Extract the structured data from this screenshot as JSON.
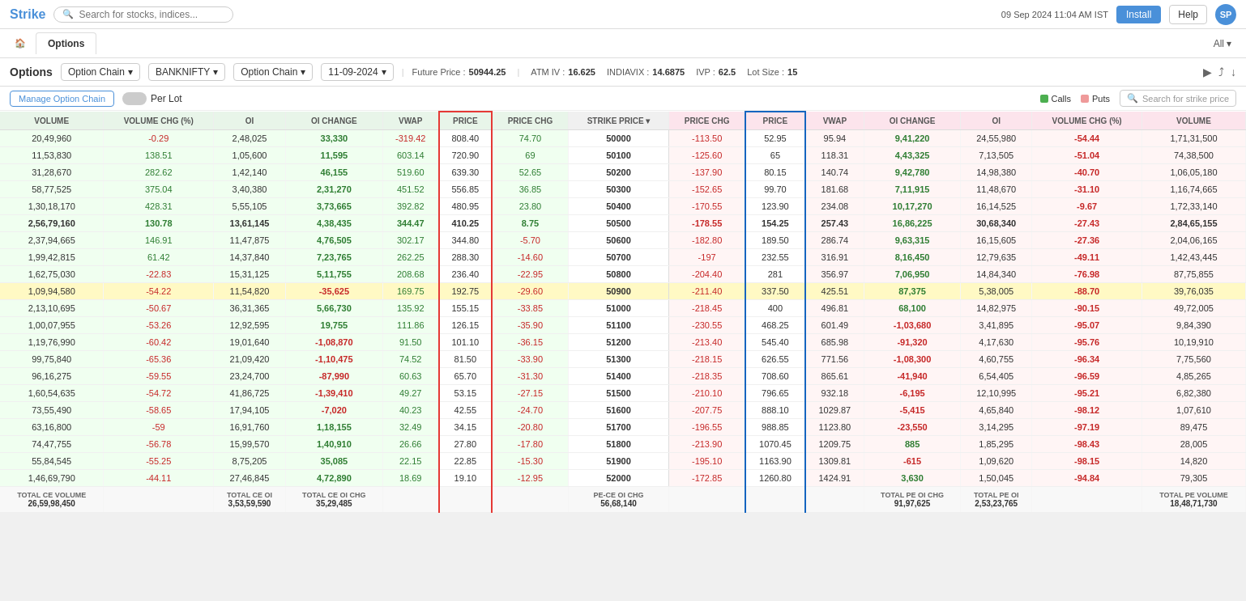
{
  "navbar": {
    "logo": "Strike",
    "search_placeholder": "Search for stocks, indices...",
    "timestamp": "09 Sep 2024 11:04 AM IST",
    "btn_install": "Install",
    "btn_help": "Help",
    "avatar": "SP"
  },
  "tabs": {
    "home_icon": "🏠",
    "active_tab": "Options",
    "all_label": "All"
  },
  "options_bar": {
    "title": "Options",
    "dropdown1": "Option Chain",
    "dropdown2": "BANKNIFTY",
    "dropdown3": "Option Chain",
    "date": "11-09-2024",
    "future_price_label": "Future Price :",
    "future_price_val": "50944.25",
    "atm_iv_label": "ATM IV :",
    "atm_iv_val": "16.625",
    "indiavix_label": "INDIAVIX :",
    "indiavix_val": "14.6875",
    "ivp_label": "IVP :",
    "ivp_val": "62.5",
    "lot_label": "Lot Size :",
    "lot_val": "15"
  },
  "manage_bar": {
    "btn_manage": "Manage Option Chain",
    "per_lot": "Per Lot",
    "legend_calls": "Calls",
    "legend_puts": "Puts",
    "search_placeholder": "Search for strike price"
  },
  "table": {
    "ce_headers": [
      "VOLUME",
      "VOLUME CHG (%)",
      "OI",
      "OI CHANGE",
      "VWAP",
      "PRICE",
      "PRICE CHG"
    ],
    "strike_header": "STRIKE PRICE",
    "pe_headers": [
      "PRICE CHG",
      "PRICE",
      "VWAP",
      "OI CHANGE",
      "OI",
      "VOLUME CHG (%)",
      "VOLUME"
    ],
    "rows": [
      {
        "strike": "50000",
        "ce": {
          "vol": "20,49,960",
          "vol_chg": "-0.29",
          "oi": "2,48,025",
          "oi_chg": "33,330",
          "vwap": "-319.42",
          "price": "808.40",
          "price_chg": "74.70"
        },
        "pe": {
          "price_chg": "-113.50",
          "price": "52.95",
          "vwap": "95.94",
          "oi_chg": "9,41,220",
          "oi": "24,55,980",
          "vol_chg": "-54.44",
          "vol": "1,71,31,500"
        }
      },
      {
        "strike": "50100",
        "ce": {
          "vol": "11,53,830",
          "vol_chg": "138.51",
          "oi": "1,05,600",
          "oi_chg": "11,595",
          "vwap": "603.14",
          "price": "720.90",
          "price_chg": "69"
        },
        "pe": {
          "price_chg": "-125.60",
          "price": "65",
          "vwap": "118.31",
          "oi_chg": "4,43,325",
          "oi": "7,13,505",
          "vol_chg": "-51.04",
          "vol": "74,38,500"
        }
      },
      {
        "strike": "50200",
        "ce": {
          "vol": "31,28,670",
          "vol_chg": "282.62",
          "oi": "1,42,140",
          "oi_chg": "46,155",
          "vwap": "519.60",
          "price": "639.30",
          "price_chg": "52.65"
        },
        "pe": {
          "price_chg": "-137.90",
          "price": "80.15",
          "vwap": "140.74",
          "oi_chg": "9,42,780",
          "oi": "14,98,380",
          "vol_chg": "-40.70",
          "vol": "1,06,05,180"
        }
      },
      {
        "strike": "50300",
        "ce": {
          "vol": "58,77,525",
          "vol_chg": "375.04",
          "oi": "3,40,380",
          "oi_chg": "2,31,270",
          "vwap": "451.52",
          "price": "556.85",
          "price_chg": "36.85"
        },
        "pe": {
          "price_chg": "-152.65",
          "price": "99.70",
          "vwap": "181.68",
          "oi_chg": "7,11,915",
          "oi": "11,48,670",
          "vol_chg": "-31.10",
          "vol": "1,16,74,665"
        }
      },
      {
        "strike": "50400",
        "ce": {
          "vol": "1,30,18,170",
          "vol_chg": "428.31",
          "oi": "5,55,105",
          "oi_chg": "3,73,665",
          "vwap": "392.82",
          "price": "480.95",
          "price_chg": "23.80"
        },
        "pe": {
          "price_chg": "-170.55",
          "price": "123.90",
          "vwap": "234.08",
          "oi_chg": "10,17,270",
          "oi": "16,14,525",
          "vol_chg": "-9.67",
          "vol": "1,72,33,140"
        }
      },
      {
        "strike": "50500",
        "ce": {
          "vol": "2,56,79,160",
          "vol_chg": "130.78",
          "oi": "13,61,145",
          "oi_chg": "4,38,435",
          "vwap": "344.47",
          "price": "410.25",
          "price_chg": "8.75"
        },
        "pe": {
          "price_chg": "-178.55",
          "price": "154.25",
          "vwap": "257.43",
          "oi_chg": "16,86,225",
          "oi": "30,68,340",
          "vol_chg": "-27.43",
          "vol": "2,84,65,155"
        },
        "atm": true
      },
      {
        "strike": "50600",
        "ce": {
          "vol": "2,37,94,665",
          "vol_chg": "146.91",
          "oi": "11,47,875",
          "oi_chg": "4,76,505",
          "vwap": "302.17",
          "price": "344.80",
          "price_chg": "-5.70"
        },
        "pe": {
          "price_chg": "-182.80",
          "price": "189.50",
          "vwap": "286.74",
          "oi_chg": "9,63,315",
          "oi": "16,15,605",
          "vol_chg": "-27.36",
          "vol": "2,04,06,165"
        }
      },
      {
        "strike": "50700",
        "ce": {
          "vol": "1,99,42,815",
          "vol_chg": "61.42",
          "oi": "14,37,840",
          "oi_chg": "7,23,765",
          "vwap": "262.25",
          "price": "288.30",
          "price_chg": "-14.60"
        },
        "pe": {
          "price_chg": "-197",
          "price": "232.55",
          "vwap": "316.91",
          "oi_chg": "8,16,450",
          "oi": "12,79,635",
          "vol_chg": "-49.11",
          "vol": "1,42,43,445"
        }
      },
      {
        "strike": "50800",
        "ce": {
          "vol": "1,62,75,030",
          "vol_chg": "-22.83",
          "oi": "15,31,125",
          "oi_chg": "5,11,755",
          "vwap": "208.68",
          "price": "236.40",
          "price_chg": "-22.95"
        },
        "pe": {
          "price_chg": "-204.40",
          "price": "281",
          "vwap": "356.97",
          "oi_chg": "7,06,950",
          "oi": "14,84,340",
          "vol_chg": "-76.98",
          "vol": "87,75,855"
        }
      },
      {
        "strike": "50900",
        "ce": {
          "vol": "1,09,94,580",
          "vol_chg": "-54.22",
          "oi": "11,54,820",
          "oi_chg": "-35,625",
          "vwap": "169.75",
          "price": "192.75",
          "price_chg": "-29.60"
        },
        "pe": {
          "price_chg": "-211.40",
          "price": "337.50",
          "vwap": "425.51",
          "oi_chg": "87,375",
          "oi": "5,38,005",
          "vol_chg": "-88.70",
          "vol": "39,76,035"
        },
        "highlight": true
      },
      {
        "strike": "51000",
        "ce": {
          "vol": "2,13,10,695",
          "vol_chg": "-50.67",
          "oi": "36,31,365",
          "oi_chg": "5,66,730",
          "vwap": "135.92",
          "price": "155.15",
          "price_chg": "-33.85"
        },
        "pe": {
          "price_chg": "-218.45",
          "price": "400",
          "vwap": "496.81",
          "oi_chg": "68,100",
          "oi": "14,82,975",
          "vol_chg": "-90.15",
          "vol": "49,72,005"
        }
      },
      {
        "strike": "51100",
        "ce": {
          "vol": "1,00,07,955",
          "vol_chg": "-53.26",
          "oi": "12,92,595",
          "oi_chg": "19,755",
          "vwap": "111.86",
          "price": "126.15",
          "price_chg": "-35.90"
        },
        "pe": {
          "price_chg": "-230.55",
          "price": "468.25",
          "vwap": "601.49",
          "oi_chg": "-1,03,680",
          "oi": "3,41,895",
          "vol_chg": "-95.07",
          "vol": "9,84,390"
        }
      },
      {
        "strike": "51200",
        "ce": {
          "vol": "1,19,76,990",
          "vol_chg": "-60.42",
          "oi": "19,01,640",
          "oi_chg": "-1,08,870",
          "vwap": "91.50",
          "price": "101.10",
          "price_chg": "-36.15"
        },
        "pe": {
          "price_chg": "-213.40",
          "price": "545.40",
          "vwap": "685.98",
          "oi_chg": "-91,320",
          "oi": "4,17,630",
          "vol_chg": "-95.76",
          "vol": "10,19,910"
        }
      },
      {
        "strike": "51300",
        "ce": {
          "vol": "99,75,840",
          "vol_chg": "-65.36",
          "oi": "21,09,420",
          "oi_chg": "-1,10,475",
          "vwap": "74.52",
          "price": "81.50",
          "price_chg": "-33.90"
        },
        "pe": {
          "price_chg": "-218.15",
          "price": "626.55",
          "vwap": "771.56",
          "oi_chg": "-1,08,300",
          "oi": "4,60,755",
          "vol_chg": "-96.34",
          "vol": "7,75,560"
        }
      },
      {
        "strike": "51400",
        "ce": {
          "vol": "96,16,275",
          "vol_chg": "-59.55",
          "oi": "23,24,700",
          "oi_chg": "-87,990",
          "vwap": "60.63",
          "price": "65.70",
          "price_chg": "-31.30"
        },
        "pe": {
          "price_chg": "-218.35",
          "price": "708.60",
          "vwap": "865.61",
          "oi_chg": "-41,940",
          "oi": "6,54,405",
          "vol_chg": "-96.59",
          "vol": "4,85,265"
        }
      },
      {
        "strike": "51500",
        "ce": {
          "vol": "1,60,54,635",
          "vol_chg": "-54.72",
          "oi": "41,86,725",
          "oi_chg": "-1,39,410",
          "vwap": "49.27",
          "price": "53.15",
          "price_chg": "-27.15"
        },
        "pe": {
          "price_chg": "-210.10",
          "price": "796.65",
          "vwap": "932.18",
          "oi_chg": "-6,195",
          "oi": "12,10,995",
          "vol_chg": "-95.21",
          "vol": "6,82,380"
        }
      },
      {
        "strike": "51600",
        "ce": {
          "vol": "73,55,490",
          "vol_chg": "-58.65",
          "oi": "17,94,105",
          "oi_chg": "-7,020",
          "vwap": "40.23",
          "price": "42.55",
          "price_chg": "-24.70"
        },
        "pe": {
          "price_chg": "-207.75",
          "price": "888.10",
          "vwap": "1029.87",
          "oi_chg": "-5,415",
          "oi": "4,65,840",
          "vol_chg": "-98.12",
          "vol": "1,07,610"
        }
      },
      {
        "strike": "51700",
        "ce": {
          "vol": "63,16,800",
          "vol_chg": "-59",
          "oi": "16,91,760",
          "oi_chg": "1,18,155",
          "vwap": "32.49",
          "price": "34.15",
          "price_chg": "-20.80"
        },
        "pe": {
          "price_chg": "-196.55",
          "price": "988.85",
          "vwap": "1123.80",
          "oi_chg": "-23,550",
          "oi": "3,14,295",
          "vol_chg": "-97.19",
          "vol": "89,475"
        }
      },
      {
        "strike": "51800",
        "ce": {
          "vol": "74,47,755",
          "vol_chg": "-56.78",
          "oi": "15,99,570",
          "oi_chg": "1,40,910",
          "vwap": "26.66",
          "price": "27.80",
          "price_chg": "-17.80"
        },
        "pe": {
          "price_chg": "-213.90",
          "price": "1070.45",
          "vwap": "1209.75",
          "oi_chg": "885",
          "oi": "1,85,295",
          "vol_chg": "-98.43",
          "vol": "28,005"
        }
      },
      {
        "strike": "51900",
        "ce": {
          "vol": "55,84,545",
          "vol_chg": "-55.25",
          "oi": "8,75,205",
          "oi_chg": "35,085",
          "vwap": "22.15",
          "price": "22.85",
          "price_chg": "-15.30"
        },
        "pe": {
          "price_chg": "-195.10",
          "price": "1163.90",
          "vwap": "1309.81",
          "oi_chg": "-615",
          "oi": "1,09,620",
          "vol_chg": "-98.15",
          "vol": "14,820"
        }
      },
      {
        "strike": "52000",
        "ce": {
          "vol": "1,46,69,790",
          "vol_chg": "-44.11",
          "oi": "27,46,845",
          "oi_chg": "4,72,890",
          "vwap": "18.69",
          "price": "19.10",
          "price_chg": "-12.95"
        },
        "pe": {
          "price_chg": "-172.85",
          "price": "1260.80",
          "vwap": "1424.91",
          "oi_chg": "3,630",
          "oi": "1,50,045",
          "vol_chg": "-94.84",
          "vol": "79,305"
        }
      }
    ],
    "footer": {
      "ce_vol_label": "TOTAL CE VOLUME",
      "ce_vol_val": "26,59,98,450",
      "ce_oi_label": "TOTAL CE OI",
      "ce_oi_val": "3,53,59,590",
      "ce_oi_chg_label": "TOTAL CE OI CHG",
      "ce_oi_chg_val": "35,29,485",
      "pe_ce_label": "PE-CE OI CHG",
      "pe_ce_val": "56,68,140",
      "pe_oi_chg_label": "TOTAL PE OI CHG",
      "pe_oi_chg_val": "91,97,625",
      "pe_oi_label": "TOTAL PE OI",
      "pe_oi_val": "2,53,23,765",
      "pe_vol_label": "TOTAL PE VOLUME",
      "pe_vol_val": "18,48,71,730"
    }
  }
}
